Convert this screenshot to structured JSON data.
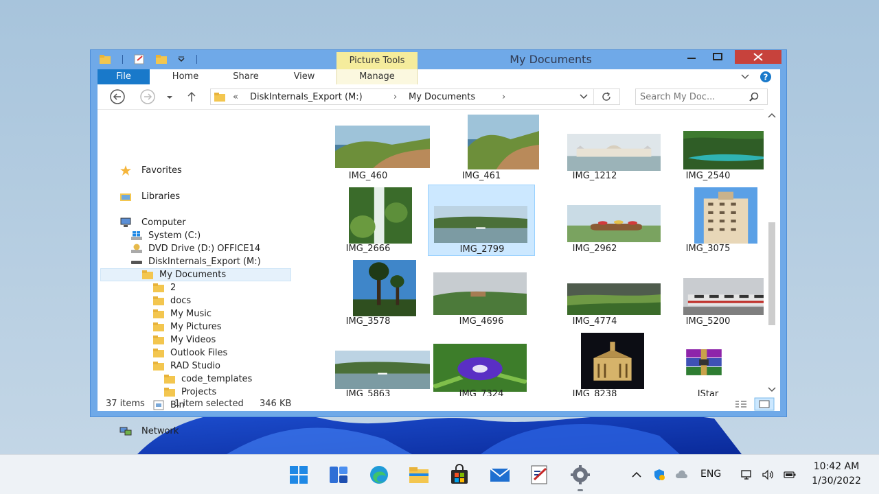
{
  "window": {
    "title": "My Documents",
    "contextual_tab_group": "Picture Tools",
    "close_glyph": "✕",
    "minimize_glyph": "—"
  },
  "ribbon": {
    "tabs": [
      "File",
      "Home",
      "Share",
      "View",
      "Manage"
    ]
  },
  "address_bar": {
    "prefix": "«",
    "crumbs": [
      "DiskInternals_Export (M:)",
      "My Documents"
    ],
    "separator": "›"
  },
  "search": {
    "placeholder": "Search My Doc..."
  },
  "navigation": {
    "favorites": "Favorites",
    "libraries": "Libraries",
    "computer": "Computer",
    "drives": [
      "System (C:)",
      "DVD Drive (D:) OFFICE14",
      "DiskInternals_Export (M:)"
    ],
    "current_folder": "My Documents",
    "subfolders": [
      "2",
      "docs",
      "My Music",
      "My Pictures",
      "My Videos",
      "Outlook Files",
      "RAD Studio"
    ],
    "rad_subfolders": [
      "code_templates",
      "Projects"
    ],
    "bin": "Bin",
    "network": "Network"
  },
  "files": [
    {
      "name": "IMG_460",
      "scene": "coast"
    },
    {
      "name": "IMG_461",
      "scene": "coast"
    },
    {
      "name": "IMG_1212",
      "scene": "parliament"
    },
    {
      "name": "IMG_2540",
      "scene": "lake"
    },
    {
      "name": "IMG_2666",
      "scene": "waterfall"
    },
    {
      "name": "IMG_2799",
      "scene": "river"
    },
    {
      "name": "IMG_2962",
      "scene": "flowers"
    },
    {
      "name": "IMG_3075",
      "scene": "building"
    },
    {
      "name": "IMG_3578",
      "scene": "palms"
    },
    {
      "name": "IMG_4696",
      "scene": "hills"
    },
    {
      "name": "IMG_4774",
      "scene": "valley"
    },
    {
      "name": "IMG_5200",
      "scene": "tram"
    },
    {
      "name": "IMG_5863",
      "scene": "river"
    },
    {
      "name": "IMG_7324",
      "scene": "flower"
    },
    {
      "name": "IMG_8238",
      "scene": "night"
    },
    {
      "name": "JStar",
      "scene": "archive"
    }
  ],
  "selected_file": "IMG_2799",
  "status": {
    "item_count": "37 items",
    "selection": "1 item selected",
    "size": "346 KB"
  },
  "taskbar": {
    "apps": [
      "start-icon",
      "widgets-icon",
      "edge-icon",
      "file-explorer-icon",
      "store-icon",
      "mail-icon",
      "editor-icon",
      "settings-icon"
    ],
    "language": "ENG",
    "time": "10:42 AM",
    "date": "1/30/2022"
  },
  "colors": {
    "window_frame": "#6fa9e8",
    "file_tab": "#1979ca",
    "close_button": "#c7423c",
    "contextual_tab": "#f5ec9c",
    "selection": "#cce8ff"
  }
}
